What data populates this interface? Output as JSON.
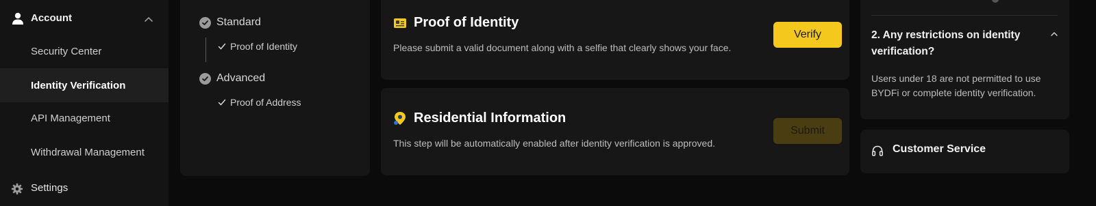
{
  "sidebar": {
    "account_label": "Account",
    "items": [
      {
        "label": "Security Center"
      },
      {
        "label": "Identity Verification"
      },
      {
        "label": "API Management"
      },
      {
        "label": "Withdrawal Management"
      }
    ],
    "settings_label": "Settings",
    "icons": {
      "account": "user-icon",
      "collapse": "chevron-up-icon",
      "settings": "gear-icon"
    }
  },
  "steps": {
    "levels": [
      {
        "name": "Standard",
        "sub": "Proof of Identity"
      },
      {
        "name": "Advanced",
        "sub": "Proof of Address"
      }
    ]
  },
  "cards": {
    "identity": {
      "title": "Proof of Identity",
      "desc": "Please submit a valid document along with a selfie that clearly shows your face.",
      "button": "Verify",
      "icon": "id-card-icon"
    },
    "residential": {
      "title": "Residential Information",
      "desc": "This step will be automatically enabled after identity verification is approved.",
      "button": "Submit",
      "icon": "location-pin-icon"
    }
  },
  "faq": {
    "question": "2. Any restrictions on identity verification?",
    "answer": "Users under 18 are not permitted to use BYDFi or complete identity verification."
  },
  "service": {
    "label": "Customer Service",
    "icon": "headphones-icon"
  },
  "colors": {
    "accent": "#f4c81d",
    "accent_disabled": "#4a3d12",
    "sidebar_bg": "#141414",
    "panel_bg": "#171718",
    "page_bg": "#0b0b0c"
  }
}
